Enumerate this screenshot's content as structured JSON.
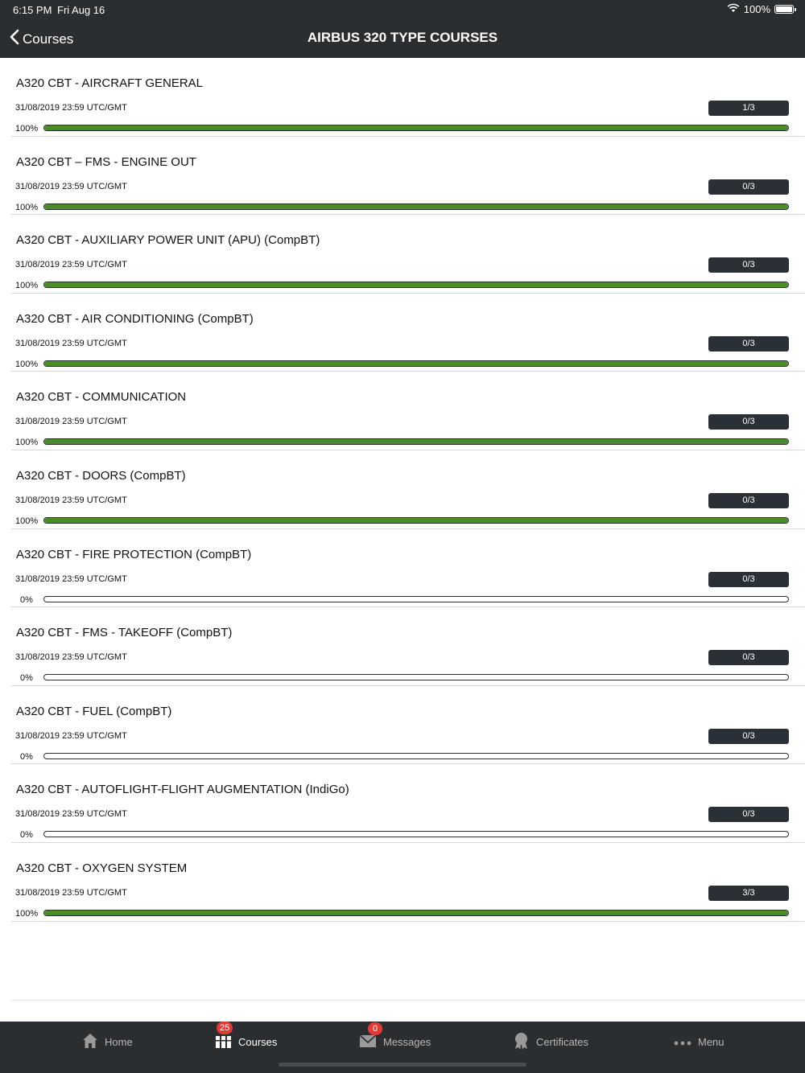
{
  "status_bar": {
    "time": "6:15 PM",
    "date": "Fri Aug 16",
    "battery": "100%"
  },
  "nav": {
    "back_label": "Courses",
    "title": "AIRBUS 320 TYPE COURSES"
  },
  "colors": {
    "bar_background": "#2b2e31",
    "progress_fill": "#4a8c2a",
    "badge_red": "#e53935"
  },
  "courses": [
    {
      "title": "A320 CBT - AIRCRAFT GENERAL",
      "deadline": "31/08/2019 23:59 UTC/GMT",
      "modules": "1/3",
      "percent_label": "100%",
      "progress": 1
    },
    {
      "title": "A320 CBT – FMS - ENGINE OUT",
      "deadline": "31/08/2019 23:59 UTC/GMT",
      "modules": "0/3",
      "percent_label": "100%",
      "progress": 1
    },
    {
      "title": "A320 CBT - AUXILIARY POWER UNIT (APU) (CompBT)",
      "deadline": "31/08/2019 23:59 UTC/GMT",
      "modules": "0/3",
      "percent_label": "100%",
      "progress": 1
    },
    {
      "title": "A320 CBT - AIR CONDITIONING (CompBT)",
      "deadline": "31/08/2019 23:59 UTC/GMT",
      "modules": "0/3",
      "percent_label": "100%",
      "progress": 1
    },
    {
      "title": "A320 CBT - COMMUNICATION",
      "deadline": "31/08/2019 23:59 UTC/GMT",
      "modules": "0/3",
      "percent_label": "100%",
      "progress": 1
    },
    {
      "title": "A320 CBT - DOORS (CompBT)",
      "deadline": "31/08/2019 23:59 UTC/GMT",
      "modules": "0/3",
      "percent_label": "100%",
      "progress": 1
    },
    {
      "title": "A320 CBT - FIRE PROTECTION (CompBT)",
      "deadline": "31/08/2019 23:59 UTC/GMT",
      "modules": "0/3",
      "percent_label": "0%",
      "progress": 0
    },
    {
      "title": "A320 CBT - FMS - TAKEOFF (CompBT)",
      "deadline": "31/08/2019 23:59 UTC/GMT",
      "modules": "0/3",
      "percent_label": "0%",
      "progress": 0
    },
    {
      "title": "A320 CBT - FUEL (CompBT)",
      "deadline": "31/08/2019 23:59 UTC/GMT",
      "modules": "0/3",
      "percent_label": "0%",
      "progress": 0
    },
    {
      "title": "A320 CBT - AUTOFLIGHT-FLIGHT AUGMENTATION (IndiGo)",
      "deadline": "31/08/2019 23:59 UTC/GMT",
      "modules": "0/3",
      "percent_label": "0%",
      "progress": 0
    },
    {
      "title": "A320 CBT - OXYGEN SYSTEM",
      "deadline": "31/08/2019 23:59 UTC/GMT",
      "modules": "3/3",
      "percent_label": "100%",
      "progress": 1
    }
  ],
  "tab_bar": {
    "home": {
      "label": "Home",
      "icon": "home-icon"
    },
    "courses": {
      "label": "Courses",
      "icon": "books-icon",
      "badge": "25"
    },
    "messages": {
      "label": "Messages",
      "icon": "envelope-icon",
      "badge": "0"
    },
    "certificates": {
      "label": "Certificates",
      "icon": "certificate-icon"
    },
    "menu": {
      "label": "Menu",
      "icon": "more-dots-icon"
    }
  }
}
